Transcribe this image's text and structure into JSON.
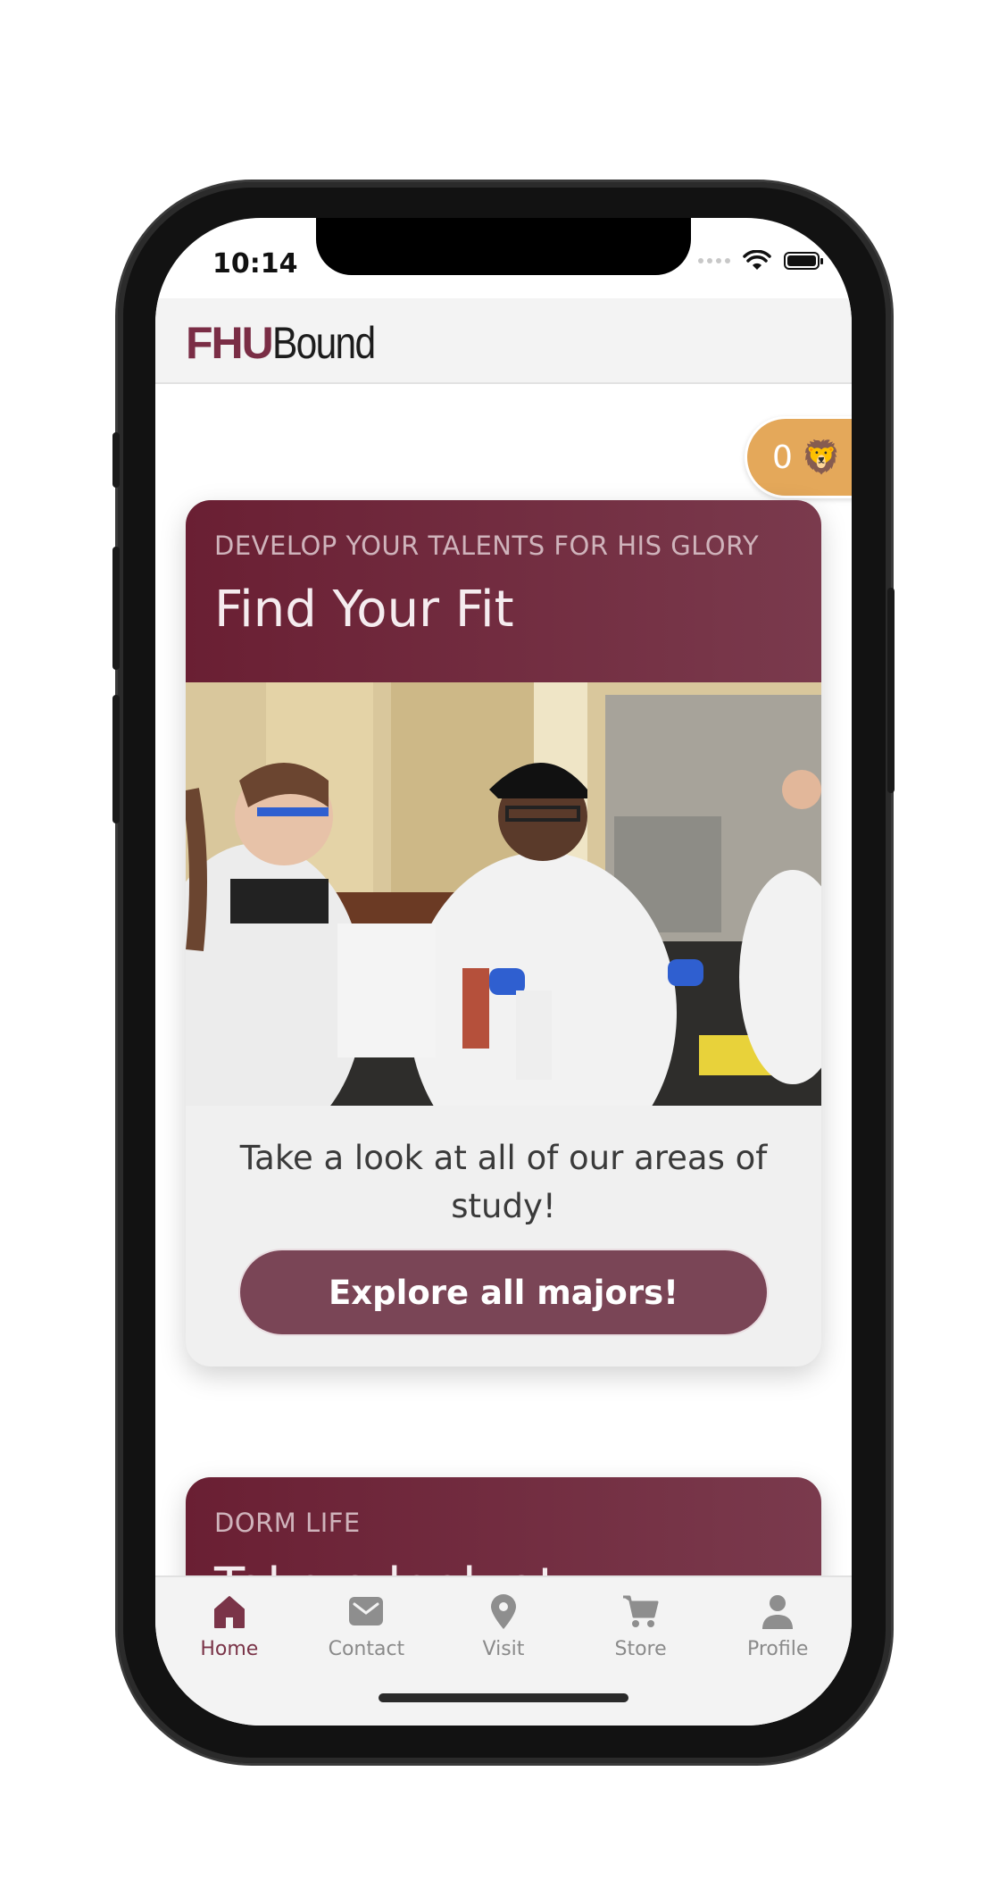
{
  "status_bar": {
    "time": "10:14"
  },
  "header": {
    "brand_fhu": "FHU",
    "brand_bound": "Bound"
  },
  "points": {
    "count": "0",
    "mascot_icon": "lion-emoji",
    "mascot_glyph": "🦁"
  },
  "cards": [
    {
      "eyebrow": "DEVELOP YOUR TALENTS FOR HIS GLORY",
      "title": "Find Your Fit",
      "image_alt": "Students working in a science lab",
      "description": "Take a look at all of our areas of study!",
      "button_label": "Explore all majors!"
    },
    {
      "eyebrow": "DORM LIFE",
      "title": "Take a look at"
    }
  ],
  "tabbar": {
    "items": [
      {
        "label": "Home",
        "icon": "home-icon",
        "active": true
      },
      {
        "label": "Contact",
        "icon": "mail-icon",
        "active": false
      },
      {
        "label": "Visit",
        "icon": "map-pin-icon",
        "active": false
      },
      {
        "label": "Store",
        "icon": "cart-icon",
        "active": false
      },
      {
        "label": "Profile",
        "icon": "user-icon",
        "active": false
      }
    ]
  },
  "colors": {
    "brand_maroon": "#6a1f33",
    "button_maroon": "#7a4556",
    "badge_gold": "#e4a85a",
    "active_tab": "#7a3448"
  }
}
